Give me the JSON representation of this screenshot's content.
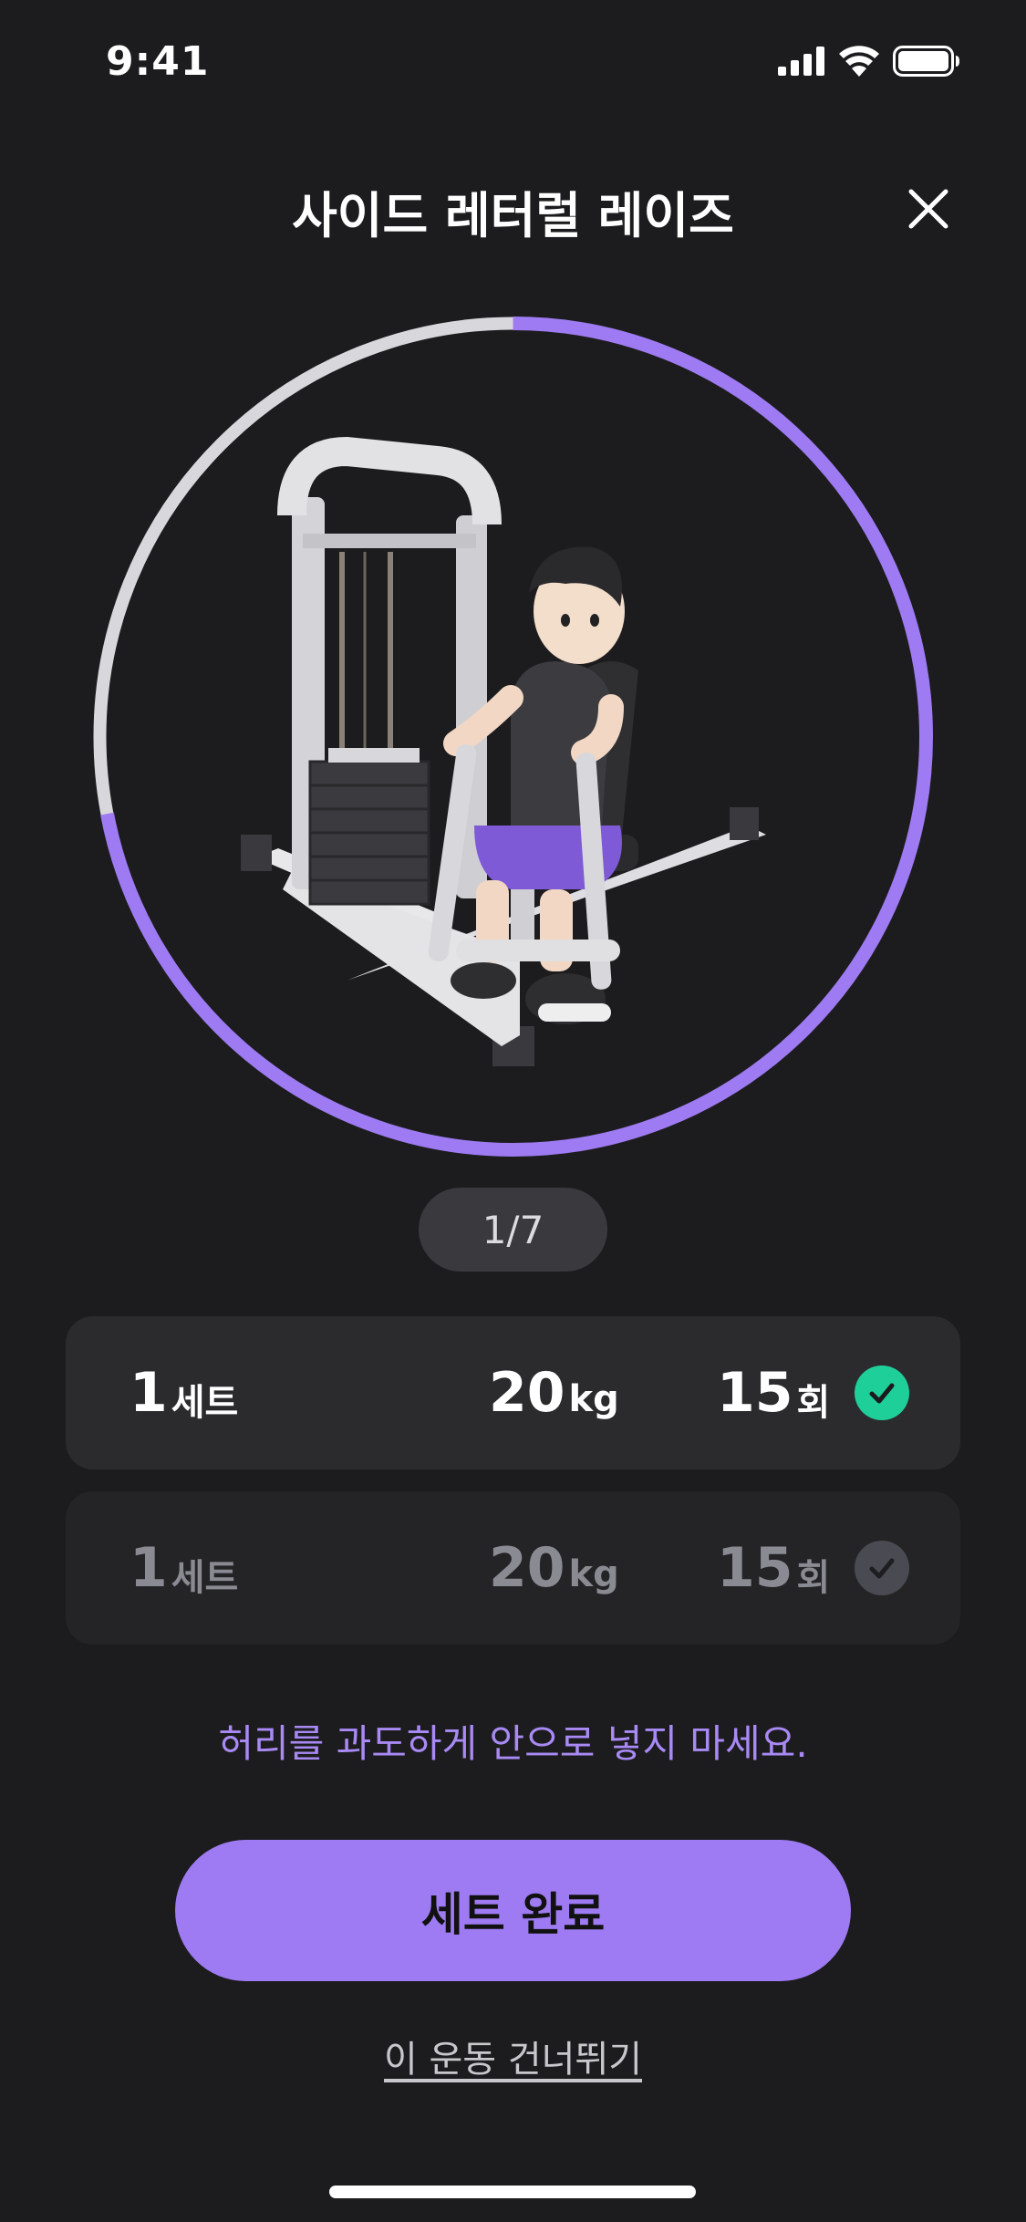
{
  "status_bar": {
    "time": "9:41"
  },
  "header": {
    "title": "사이드 레터럴 레이즈"
  },
  "icons": {
    "close": "close-icon",
    "check": "checkmark-icon"
  },
  "progress": {
    "exercise_index": 1,
    "exercise_total": 7,
    "counter_text": "1/7",
    "ring_fraction": 0.72
  },
  "colors": {
    "accent": "#9e7bf2",
    "done_green": "#1fcf9a",
    "background": "#1c1c1e"
  },
  "sets": [
    {
      "set_number": "1",
      "set_unit": "세트",
      "weight": "20",
      "weight_unit": "kg",
      "reps": "15",
      "reps_unit": "회",
      "status": "completed"
    },
    {
      "set_number": "1",
      "set_unit": "세트",
      "weight": "20",
      "weight_unit": "kg",
      "reps": "15",
      "reps_unit": "회",
      "status": "pending"
    }
  ],
  "tip": "허리를 과도하게 안으로 넣지 마세요.",
  "actions": {
    "complete_label": "세트 완료",
    "skip_label": "이 운동 건너뛰기"
  }
}
